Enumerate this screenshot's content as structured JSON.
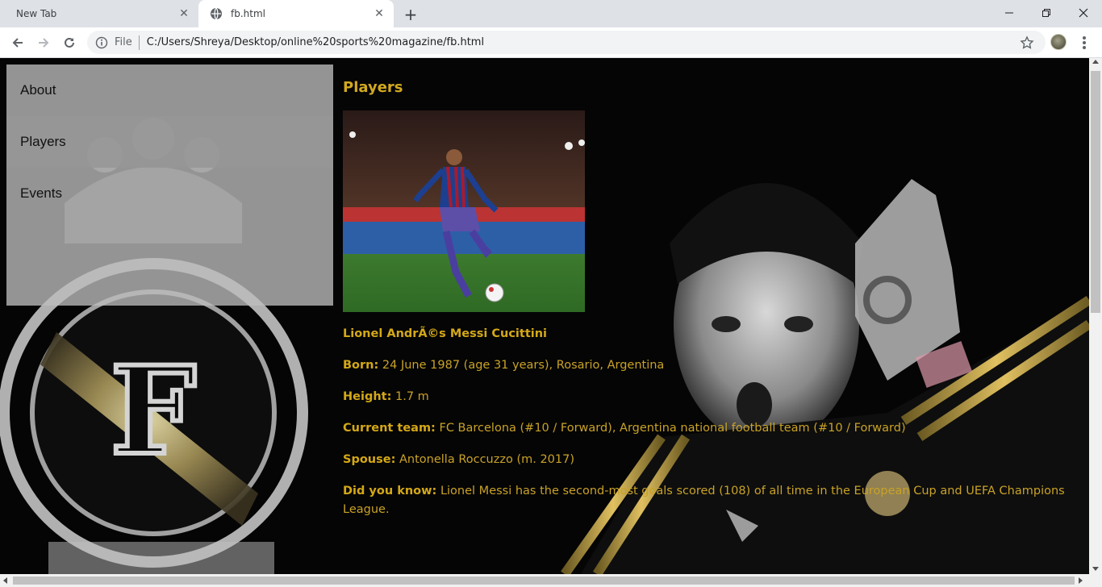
{
  "browser": {
    "tabs": [
      {
        "title": "New Tab",
        "active": false
      },
      {
        "title": "fb.html",
        "active": true
      }
    ],
    "omnibox": {
      "scheme_label": "File",
      "url": "C:/Users/Shreya/Desktop/online%20sports%20magazine/fb.html"
    }
  },
  "page": {
    "menu": {
      "items": [
        {
          "label": "About",
          "active": false
        },
        {
          "label": "Players",
          "active": true
        },
        {
          "label": "Events",
          "active": false
        }
      ]
    },
    "heading": "Players",
    "player": {
      "name": "Lionel AndrÃ©s Messi Cucittini",
      "born_label": "Born:",
      "born_value": " 24 June 1987 (age 31 years), Rosario, Argentina",
      "height_label": "Height:",
      "height_value": " 1.7 m",
      "team_label": "Current team:",
      "team_value": " FC Barcelona (#10 / Forward), Argentina national football team (#10 / Forward)",
      "spouse_label": "Spouse:",
      "spouse_value": " Antonella Roccuzzo (m. 2017)",
      "fact_label": "Did you know:",
      "fact_value": " Lionel Messi has the second-most goals scored (108) of all time in the European Cup and UEFA Champions League."
    }
  },
  "colors": {
    "text_gold": "#c9a227",
    "menu_bg": "#bcbcbc",
    "menu_active_bg": "#969696",
    "chrome_bg": "#dee1e6"
  }
}
